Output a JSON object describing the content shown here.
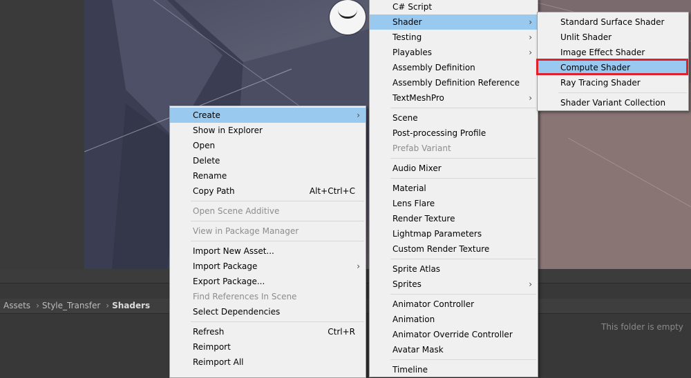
{
  "breadcrumb": {
    "items": [
      "Assets",
      "Style_Transfer",
      "Shaders"
    ]
  },
  "project": {
    "empty_message": "This folder is empty"
  },
  "context_menu": {
    "items": [
      {
        "label": "Create",
        "submenu": true,
        "active": true
      },
      {
        "label": "Show in Explorer"
      },
      {
        "label": "Open"
      },
      {
        "label": "Delete"
      },
      {
        "label": "Rename"
      },
      {
        "label": "Copy Path",
        "shortcut": "Alt+Ctrl+C"
      },
      {
        "label": "Open Scene Additive",
        "disabled": true
      },
      {
        "label": "View in Package Manager",
        "disabled": true
      },
      {
        "label": "Import New Asset..."
      },
      {
        "label": "Import Package",
        "submenu": true
      },
      {
        "label": "Export Package..."
      },
      {
        "label": "Find References In Scene",
        "disabled": true
      },
      {
        "label": "Select Dependencies"
      },
      {
        "label": "Refresh",
        "shortcut": "Ctrl+R"
      },
      {
        "label": "Reimport"
      },
      {
        "label": "Reimport All"
      }
    ]
  },
  "create_menu": {
    "items": [
      {
        "label": "C# Script"
      },
      {
        "label": "Shader",
        "submenu": true,
        "active": true
      },
      {
        "label": "Testing",
        "submenu": true
      },
      {
        "label": "Playables",
        "submenu": true
      },
      {
        "label": "Assembly Definition"
      },
      {
        "label": "Assembly Definition Reference"
      },
      {
        "label": "TextMeshPro",
        "submenu": true
      },
      {
        "label": "Scene"
      },
      {
        "label": "Post-processing Profile"
      },
      {
        "label": "Prefab Variant",
        "disabled": true
      },
      {
        "label": "Audio Mixer"
      },
      {
        "label": "Material"
      },
      {
        "label": "Lens Flare"
      },
      {
        "label": "Render Texture"
      },
      {
        "label": "Lightmap Parameters"
      },
      {
        "label": "Custom Render Texture"
      },
      {
        "label": "Sprite Atlas"
      },
      {
        "label": "Sprites",
        "submenu": true
      },
      {
        "label": "Animator Controller"
      },
      {
        "label": "Animation"
      },
      {
        "label": "Animator Override Controller"
      },
      {
        "label": "Avatar Mask"
      },
      {
        "label": "Timeline"
      }
    ]
  },
  "shader_menu": {
    "items": [
      {
        "label": "Standard Surface Shader"
      },
      {
        "label": "Unlit Shader"
      },
      {
        "label": "Image Effect Shader"
      },
      {
        "label": "Compute Shader",
        "active": true
      },
      {
        "label": "Ray Tracing Shader"
      },
      {
        "label": "Shader Variant Collection"
      }
    ]
  },
  "symbols": {
    "submenu_arrow": "›",
    "breadcrumb_sep": "›"
  }
}
